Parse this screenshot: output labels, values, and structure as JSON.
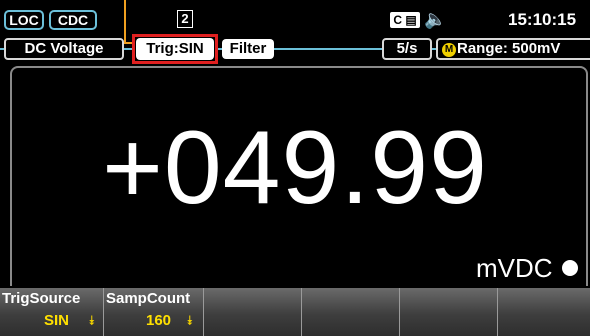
{
  "status": {
    "loc_label": "LOC",
    "cdc_label": "CDC",
    "page_number": "2",
    "ce_label": "C",
    "clock": "15:10:15"
  },
  "tabs": {
    "function": "DC Voltage",
    "trigger": "Trig:SIN",
    "filter": "Filter",
    "rate": "5/s",
    "range_badge": "M",
    "range": "Range: 500mV"
  },
  "display": {
    "reading": "+049.99",
    "unit": "mVDC"
  },
  "softkeys": [
    {
      "title": "TrigSource",
      "value": "SIN"
    },
    {
      "title": "SampCount",
      "value": "160"
    }
  ],
  "colors": {
    "highlight": "#e02020",
    "annotation": "#f0a020",
    "softkey_value": "#ffe000",
    "frame_accent": "#6cc0d9"
  },
  "icons": {
    "ce": "ce-icon",
    "speaker": "speaker-icon",
    "softkey_arrow": "arrow-down-icon"
  }
}
